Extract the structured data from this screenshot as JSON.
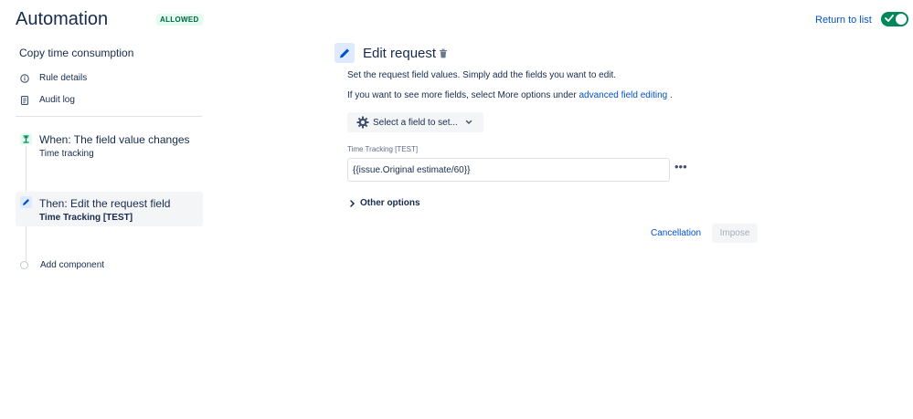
{
  "header": {
    "title": "Automation",
    "status_badge": "ALLOWED",
    "return_link": "Return to list"
  },
  "sidebar": {
    "rule_name": "Copy time consumption",
    "links": [
      {
        "label": "Rule details",
        "icon": "info-icon"
      },
      {
        "label": "Audit log",
        "icon": "document-icon"
      }
    ],
    "steps": [
      {
        "title": "When: The field value changes",
        "subtitle": "Time tracking",
        "icon": "trigger-icon"
      },
      {
        "title": "Then: Edit the request field",
        "subtitle": "Time Tracking [TEST]",
        "icon": "pencil-icon"
      }
    ],
    "add_component": "Add component"
  },
  "panel": {
    "title": "Edit request",
    "description_1": "Set the request field values. Simply add the fields you want to edit.",
    "description_2_prefix": "If you want to see more fields, select More options under",
    "description_2_link": "advanced field editing",
    "description_2_suffix": " .",
    "select_field_label": "Select a field to set...",
    "field_label": "Time Tracking [TEST]",
    "field_value": "{{issue.Original estimate/60}}",
    "more_label": "•••",
    "other_options": "Other options",
    "cancel_label": "Cancellation",
    "submit_label": "Impose"
  },
  "colors": {
    "accent": "#0052cc",
    "toggle_on": "#00875a",
    "badge_bg": "#e3fcef",
    "badge_text": "#006644"
  }
}
